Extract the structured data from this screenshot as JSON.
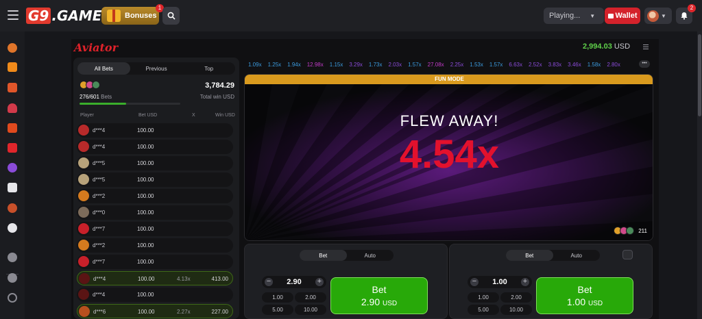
{
  "header": {
    "logo": "G9.GAME",
    "bonuses_label": "Bonuses",
    "bonuses_badge": "1",
    "playing_label": "Playing...",
    "wallet_label": "Wallet",
    "notifications_badge": "2"
  },
  "game": {
    "title": "Aviator",
    "balance": "2,994.03",
    "currency": "USD",
    "history": [
      {
        "v": "1.09x",
        "c": "#3b9bdf"
      },
      {
        "v": "1.25x",
        "c": "#3b9bdf"
      },
      {
        "v": "1.94x",
        "c": "#3b9bdf"
      },
      {
        "v": "12.98x",
        "c": "#c23bc8"
      },
      {
        "v": "1.15x",
        "c": "#3b9bdf"
      },
      {
        "v": "3.29x",
        "c": "#8a4bd8"
      },
      {
        "v": "1.73x",
        "c": "#3b9bdf"
      },
      {
        "v": "2.03x",
        "c": "#8a4bd8"
      },
      {
        "v": "1.57x",
        "c": "#3b9bdf"
      },
      {
        "v": "27.08x",
        "c": "#c23bc8"
      },
      {
        "v": "2.25x",
        "c": "#8a4bd8"
      },
      {
        "v": "1.53x",
        "c": "#3b9bdf"
      },
      {
        "v": "1.57x",
        "c": "#3b9bdf"
      },
      {
        "v": "6.63x",
        "c": "#8a4bd8"
      },
      {
        "v": "2.52x",
        "c": "#8a4bd8"
      },
      {
        "v": "3.83x",
        "c": "#8a4bd8"
      },
      {
        "v": "3.46x",
        "c": "#8a4bd8"
      },
      {
        "v": "1.58x",
        "c": "#3b9bdf"
      },
      {
        "v": "2.80x",
        "c": "#8a4bd8"
      }
    ],
    "fun_mode": "FUN MODE",
    "flew_away": "FLEW AWAY!",
    "multiplier": "4.54x",
    "players_count": "211"
  },
  "bets_panel": {
    "tabs": [
      "All Bets",
      "Previous",
      "Top"
    ],
    "bets_count": "276/601",
    "bets_word": "Bets",
    "bets_progress": 0.46,
    "total_win": "3,784.29",
    "total_win_label": "Total win USD",
    "columns": [
      "Player",
      "Bet USD",
      "X",
      "Win USD"
    ],
    "rows": [
      {
        "player": "d***4",
        "bet": "100.00",
        "x": "",
        "win": "",
        "win_row": false,
        "avatar": "#b82a2a"
      },
      {
        "player": "d***4",
        "bet": "100.00",
        "x": "",
        "win": "",
        "win_row": false,
        "avatar": "#b82a2a"
      },
      {
        "player": "d***5",
        "bet": "100.00",
        "x": "",
        "win": "",
        "win_row": false,
        "avatar": "#b7a27a"
      },
      {
        "player": "d***5",
        "bet": "100.00",
        "x": "",
        "win": "",
        "win_row": false,
        "avatar": "#b7a27a"
      },
      {
        "player": "d***2",
        "bet": "100.00",
        "x": "",
        "win": "",
        "win_row": false,
        "avatar": "#d47a1e"
      },
      {
        "player": "d***0",
        "bet": "100.00",
        "x": "",
        "win": "",
        "win_row": false,
        "avatar": "#7c6b5a"
      },
      {
        "player": "d***7",
        "bet": "100.00",
        "x": "",
        "win": "",
        "win_row": false,
        "avatar": "#c8202a"
      },
      {
        "player": "d***2",
        "bet": "100.00",
        "x": "",
        "win": "",
        "win_row": false,
        "avatar": "#d47a1e"
      },
      {
        "player": "d***7",
        "bet": "100.00",
        "x": "",
        "win": "",
        "win_row": false,
        "avatar": "#c8202a"
      },
      {
        "player": "d***4",
        "bet": "100.00",
        "x": "4.13x",
        "win": "413.00",
        "win_row": true,
        "avatar": "#5a1414"
      },
      {
        "player": "d***4",
        "bet": "100.00",
        "x": "",
        "win": "",
        "win_row": false,
        "avatar": "#5a1414"
      },
      {
        "player": "d***6",
        "bet": "100.00",
        "x": "2.27x",
        "win": "227.00",
        "win_row": true,
        "avatar": "#b8501e"
      }
    ]
  },
  "bet_panels": [
    {
      "tab_bet": "Bet",
      "tab_auto": "Auto",
      "amount": "2.90",
      "chips": [
        "1.00",
        "2.00",
        "5.00",
        "10.00"
      ],
      "button_label": "Bet",
      "button_amount": "2.90",
      "button_currency": "USD"
    },
    {
      "tab_bet": "Bet",
      "tab_auto": "Auto",
      "amount": "1.00",
      "chips": [
        "1.00",
        "2.00",
        "5.00",
        "10.00"
      ],
      "button_label": "Bet",
      "button_amount": "1.00",
      "button_currency": "USD"
    }
  ]
}
